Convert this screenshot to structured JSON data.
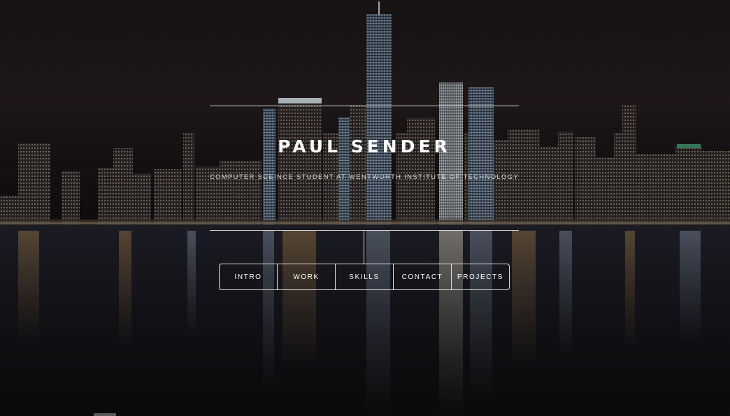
{
  "hero": {
    "title": "PAUL SENDER",
    "subtitle": "COMPUTER SCEINCE STUDENT AT WENTWORTH INSTITUTE OF TECHNOLOGY",
    "background": "night-city-skyline-reflection-image"
  },
  "nav": {
    "items": [
      {
        "label": "INTRO"
      },
      {
        "label": "WORK"
      },
      {
        "label": "SKILLS"
      },
      {
        "label": "CONTACT"
      },
      {
        "label": "PROJECTS"
      }
    ]
  },
  "colors": {
    "background": "#0d0b0c",
    "text": "#ffffff",
    "rule": "#d9d9d9"
  }
}
